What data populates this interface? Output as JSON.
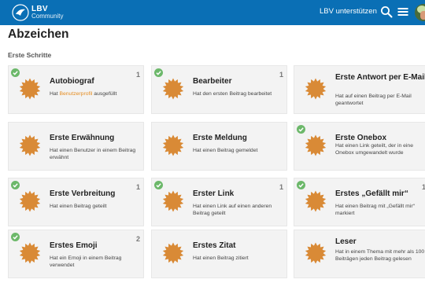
{
  "header": {
    "logo_line1": "LBV",
    "logo_line2": "Community",
    "support_label": "LBV unterstützen",
    "icons": [
      "search-icon",
      "menu-icon",
      "user-avatar"
    ],
    "bg_color": "#0a6fb5"
  },
  "page": {
    "title": "Abzeichen",
    "section": "Erste Schritte"
  },
  "badges": [
    {
      "title": "Autobiograf",
      "desc_pre": "Hat ",
      "desc_link": "Benutzerprofil",
      "desc_post": " ausgefüllt",
      "count": "1",
      "granted": true
    },
    {
      "title": "Bearbeiter",
      "desc": "Hat den ersten Beitrag bearbeitet",
      "count": "1",
      "granted": true
    },
    {
      "title": "Erste Antwort per E-Mail",
      "desc": "Hat auf einen Beitrag per E-Mail geantwortet",
      "count": "",
      "granted": false
    },
    {
      "title": "Erste Erwähnung",
      "desc": "Hat einen Benutzer in einem Beitrag erwähnt",
      "count": "",
      "granted": false
    },
    {
      "title": "Erste Meldung",
      "desc": "Hat einen Beitrag gemeldet",
      "count": "",
      "granted": false
    },
    {
      "title": "Erste Onebox",
      "desc": "Hat einen Link geteilt, der in eine Onebox umgewandelt wurde",
      "count": "",
      "granted": true
    },
    {
      "title": "Erste Verbreitung",
      "desc": "Hat einen Beitrag geteilt",
      "count": "1",
      "granted": true
    },
    {
      "title": "Erster Link",
      "desc": "Hat einen Link auf einen anderen Beitrag geteilt",
      "count": "1",
      "granted": true
    },
    {
      "title": "Erstes „Gefällt mir“",
      "desc": "Hat einen Beitrag mit „Gefällt mir“ markiert",
      "count": "1",
      "granted": true
    },
    {
      "title": "Erstes Emoji",
      "desc": "Hat ein Emoji in einem Beitrag verwendet",
      "count": "2",
      "granted": true
    },
    {
      "title": "Erstes Zitat",
      "desc": "Hat einen Beitrag zitiert",
      "count": "",
      "granted": false
    },
    {
      "title": "Leser",
      "desc": "Hat in einem Thema mit mehr als 100 Beiträgen jeden Beitrag gelesen",
      "count": "",
      "granted": false
    }
  ],
  "colors": {
    "badge_star": "#d98a36",
    "check": "#6cb86a",
    "link": "#e58b1e"
  }
}
